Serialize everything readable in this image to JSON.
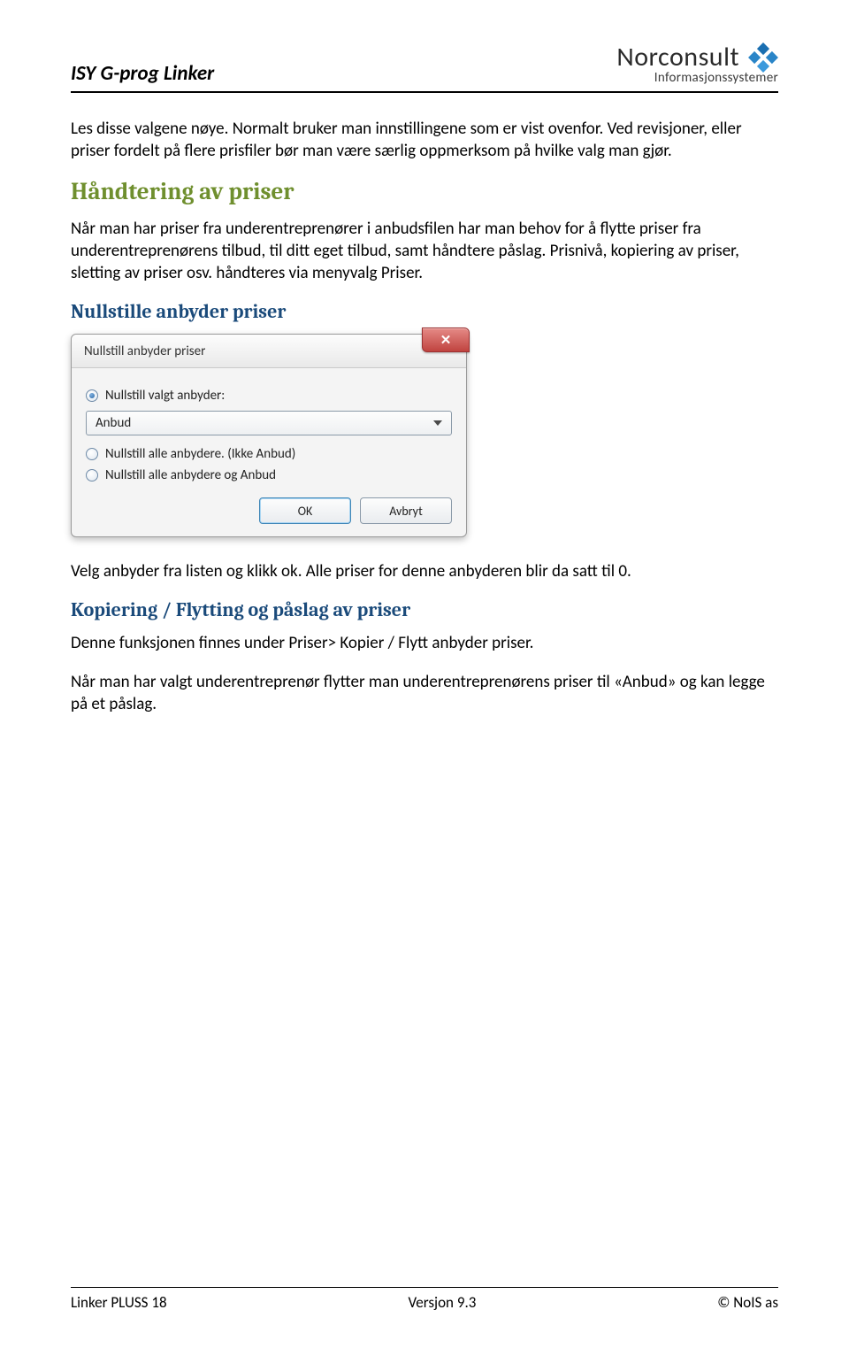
{
  "header": {
    "title": "ISY G-prog Linker",
    "brand_line1": "Norconsult",
    "brand_line2": "Informasjonssystemer"
  },
  "body": {
    "p1": "Les disse valgene nøye. Normalt bruker man innstillingene som er vist ovenfor. Ved revisjoner, eller priser fordelt på flere prisfiler bør man være særlig oppmerksom på hvilke valg man gjør.",
    "h_green": "Håndtering av priser",
    "p2": "Når man har priser fra underentreprenører i anbudsfilen har man behov for å flytte priser fra underentreprenørens tilbud, til ditt eget tilbud, samt håndtere påslag. Prisnivå, kopiering av priser, sletting av priser osv. håndteres via menyvalg Priser.",
    "h_blue1": "Nullstille anbyder priser",
    "p3": "Velg anbyder fra listen og klikk ok. Alle priser for denne anbyderen blir da satt til 0.",
    "h_blue2": "Kopiering / Flytting og påslag av priser",
    "p4": "Denne funksjonen finnes under Priser> Kopier / Flytt anbyder priser.",
    "p5": "Når man har valgt underentreprenør flytter man underentreprenørens priser til «Anbud» og kan legge på et påslag."
  },
  "dialog": {
    "title": "Nullstill anbyder priser",
    "opt1": "Nullstill valgt anbyder:",
    "dropdown_value": "Anbud",
    "opt2": "Nullstill alle anbydere. (Ikke Anbud)",
    "opt3": "Nullstill alle anbydere og Anbud",
    "ok": "OK",
    "cancel": "Avbryt"
  },
  "footer": {
    "left": "Linker PLUSS 18",
    "center": "Versjon 9.3",
    "right": "© NoIS as"
  }
}
